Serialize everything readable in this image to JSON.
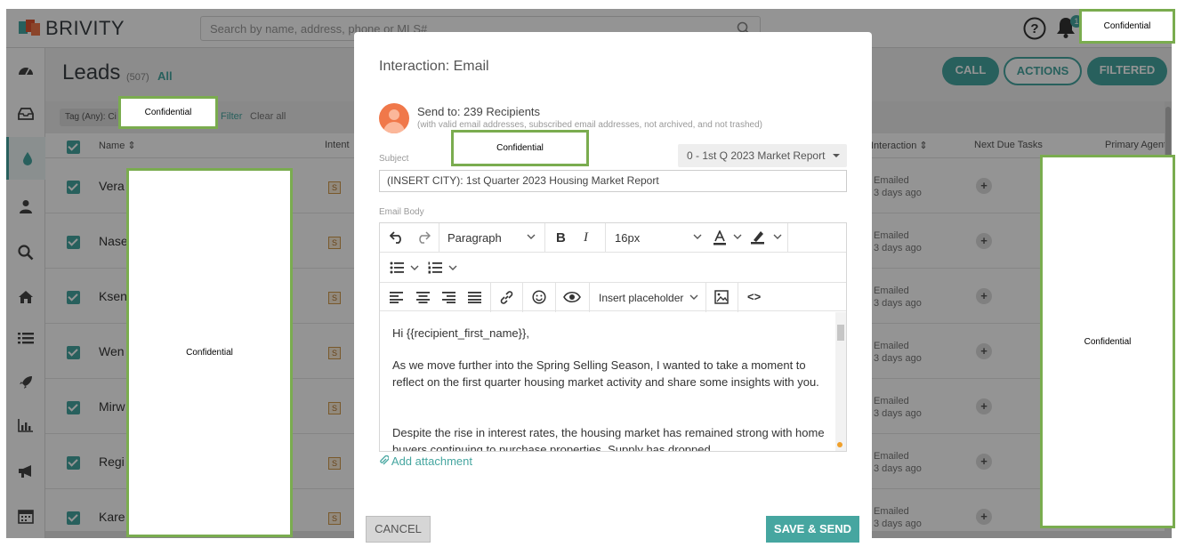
{
  "app": {
    "brand": "BRIVITY",
    "search_placeholder": "Search by name, address, phone or MLS#",
    "notification_count": "1"
  },
  "leads": {
    "title": "Leads",
    "count": "(507)",
    "all_link": "All",
    "buttons": {
      "call": "CALL",
      "actions": "ACTIONS",
      "filtered": "FILTERED"
    },
    "tag_chip": "Tag (Any): Ci",
    "filter_link": "Filter",
    "clear_link": "Clear all",
    "columns": {
      "name": "Name ⇕",
      "intent": "Intent",
      "interaction": "Interaction ⇕",
      "next_due": "Next Due Tasks",
      "primary_agent": "Primary Agent"
    },
    "rows": [
      {
        "name": "Vera",
        "intent": "S",
        "status": "Emailed",
        "when": "3 days ago"
      },
      {
        "name": "Nase",
        "intent": "S",
        "status": "Emailed",
        "when": "3 days ago"
      },
      {
        "name": "Ksen",
        "intent": "S",
        "status": "Emailed",
        "when": "3 days ago"
      },
      {
        "name": "Wen",
        "intent": "S",
        "status": "Emailed",
        "when": "3 days ago"
      },
      {
        "name": "Mirw",
        "intent": "S",
        "status": "Emailed",
        "when": "3 days ago"
      },
      {
        "name": "Regi",
        "intent": "S",
        "status": "Emailed",
        "when": "3 days ago"
      },
      {
        "name": "Kare",
        "intent": "S",
        "status": "Emailed",
        "when": "3 days ago"
      }
    ]
  },
  "modal": {
    "title": "Interaction: Email",
    "send_to": "Send to: 239 Recipients",
    "send_to_note": "(with valid email addresses, subscribed email addresses, not archived, and not trashed)",
    "subject_label": "Subject",
    "template_value": "0 - 1st Q 2023 Market Report",
    "subject_value": "(INSERT CITY): 1st Quarter 2023 Housing Market Report",
    "body_label": "Email Body",
    "toolbar": {
      "block_format": "Paragraph",
      "bold": "B",
      "italic": "I",
      "font_size": "16px",
      "insert_placeholder": "Insert placeholder",
      "code": "<>"
    },
    "body_paragraphs": [
      "Hi {{recipient_first_name}},",
      "As we move further into the Spring Selling Season, I wanted to take a moment to reflect on the first quarter housing market activity and share some insights with you.",
      "Despite the rise in interest rates, the housing market has remained strong with home buyers continuing to purchase properties. Supply has dropped"
    ],
    "add_attachment": "Add attachment",
    "cancel": "CANCEL",
    "save_send": "SAVE & SEND"
  },
  "redactions": {
    "label": "Confidential"
  },
  "colors": {
    "accent": "#46a6a0",
    "redaction_border": "#7aac4f",
    "avatar": "#f0784a"
  }
}
